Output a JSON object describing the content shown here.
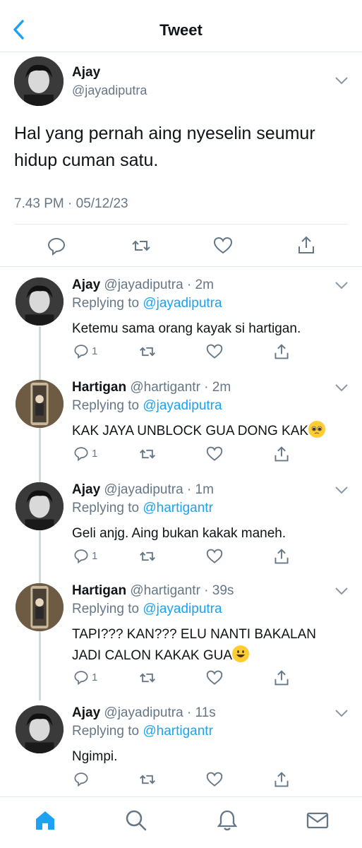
{
  "header": {
    "title": "Tweet"
  },
  "main_tweet": {
    "name": "Ajay",
    "handle": "@jayadiputra",
    "text": "Hal yang pernah aing nyeselin seumur hidup cuman satu.",
    "timestamp": "7.43 PM · 05/12/23"
  },
  "replies": [
    {
      "name": "Ajay",
      "handle_time": "@jayadiputra · 2m",
      "replying_prefix": "Replying to ",
      "replying_to": "@jayadiputra",
      "text": "Ketemu sama orang kayak si hartigan.",
      "reply_count": "1"
    },
    {
      "name": "Hartigan",
      "handle_time": "@hartigantr · 2m",
      "replying_prefix": "Replying to ",
      "replying_to": "@jayadiputra",
      "text": "KAK JAYA UNBLOCK GUA DONG KAK",
      "reply_count": "1"
    },
    {
      "name": "Ajay",
      "handle_time": "@jayadiputra · 1m",
      "replying_prefix": "Replying to ",
      "replying_to": "@hartigantr",
      "text": "Geli anjg. Aing bukan kakak maneh.",
      "reply_count": "1"
    },
    {
      "name": "Hartigan",
      "handle_time": "@hartigantr · 39s",
      "replying_prefix": "Replying to ",
      "replying_to": "@jayadiputra",
      "text": "TAPI??? KAN??? ELU NANTI BAKALAN JADI CALON KAKAK GUA",
      "reply_count": "1"
    },
    {
      "name": "Ajay",
      "handle_time": "@jayadiputra · 11s",
      "replying_prefix": "Replying to ",
      "replying_to": "@hartigantr",
      "text": "Ngimpi.",
      "reply_count": ""
    }
  ],
  "icons": {
    "back": "chevron-left-icon",
    "reply": "reply-icon",
    "retweet": "retweet-icon",
    "like": "heart-icon",
    "share": "share-icon",
    "more": "chevron-down-icon",
    "emoji_pleading": "pleading-face-emoji",
    "emoji_smile": "smiley-emoji"
  },
  "tabbar": {
    "items": [
      "home-icon",
      "search-icon",
      "notifications-icon",
      "messages-icon"
    ]
  },
  "colors": {
    "accent": "#1da1f2",
    "secondary_text": "#657786",
    "divider": "#e1e8ed"
  }
}
